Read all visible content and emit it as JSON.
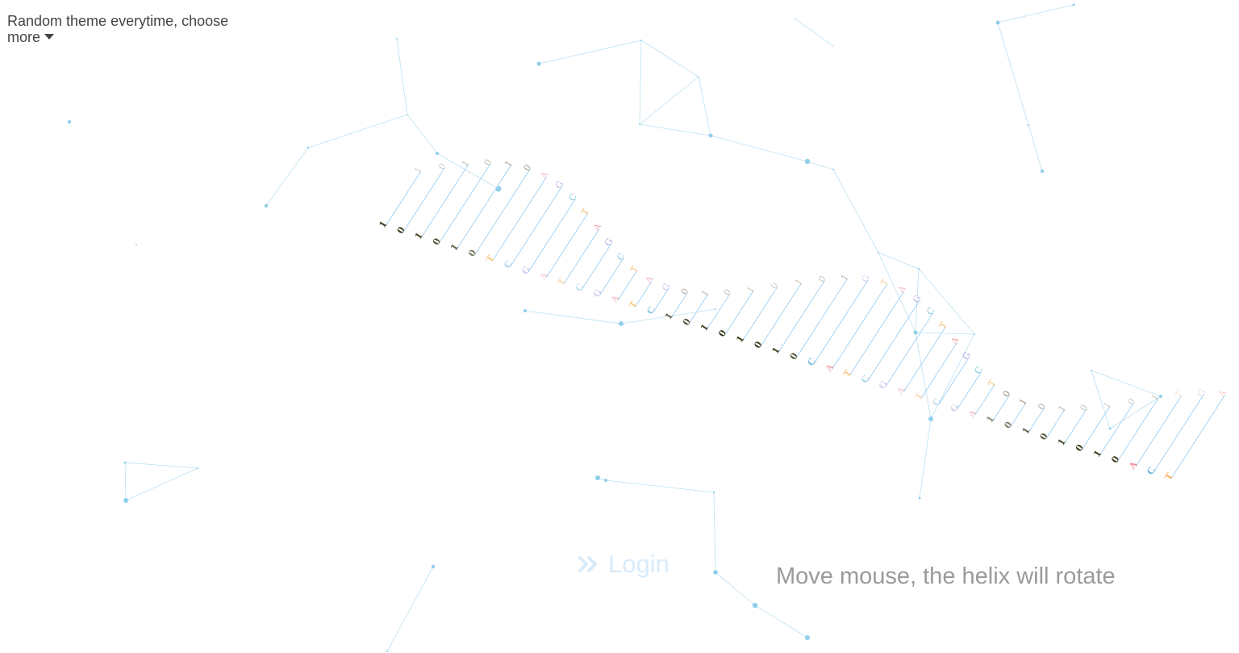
{
  "theme_menu": {
    "label_line1": "Random theme everytime, choose",
    "label_line2": "more",
    "caret_icon": "caret-down-icon"
  },
  "login": {
    "label": "Login",
    "icon": "double-chevron-right-icon"
  },
  "hint": {
    "text": "Move mouse, the helix will rotate"
  },
  "colors": {
    "network_line": "#a8d6ee",
    "network_node": "#8fcfe9",
    "helix_strand": "#9fd0f3",
    "binary_text": "#3a3a1a",
    "letter_A": "#f08f9a",
    "letter_T": "#f5a13b",
    "letter_C": "#5aaed6",
    "letter_G": "#9a8fe0",
    "login_text": "#d8ebfb",
    "hint_text": "#9a9a9a"
  },
  "helix": {
    "segments": [
      {
        "kind": "binary",
        "front": [
          "1",
          "0",
          "1",
          "0",
          "1",
          "0"
        ],
        "back": [
          "1",
          "0",
          "1",
          "0",
          "1",
          "0"
        ]
      },
      {
        "kind": "dna",
        "front": [
          "T",
          "C",
          "G",
          "A",
          "T",
          "C",
          "G",
          "A",
          "T",
          "C"
        ],
        "back": [
          "A",
          "G",
          "C",
          "T",
          "A",
          "G",
          "C",
          "T",
          "A",
          "G"
        ]
      },
      {
        "kind": "binary",
        "front": [
          "1",
          "0",
          "1",
          "0",
          "1",
          "0",
          "1",
          "0"
        ],
        "back": [
          "0",
          "1",
          "0",
          "1",
          "0",
          "1",
          "0",
          "1"
        ]
      },
      {
        "kind": "dna",
        "front": [
          "C",
          "A",
          "T",
          "C",
          "G",
          "A",
          "T",
          "C",
          "G",
          "A"
        ],
        "back": [
          "G",
          "T",
          "A",
          "G",
          "C",
          "T",
          "A",
          "G",
          "C",
          "T"
        ]
      },
      {
        "kind": "binary",
        "front": [
          "1",
          "0",
          "1",
          "0",
          "1",
          "0",
          "1",
          "0"
        ],
        "back": [
          "0",
          "1",
          "0",
          "1",
          "0",
          "1",
          "0",
          "1"
        ]
      },
      {
        "kind": "dna",
        "front": [
          "A",
          "C",
          "T"
        ],
        "back": [
          "T",
          "G",
          "A"
        ]
      }
    ]
  }
}
